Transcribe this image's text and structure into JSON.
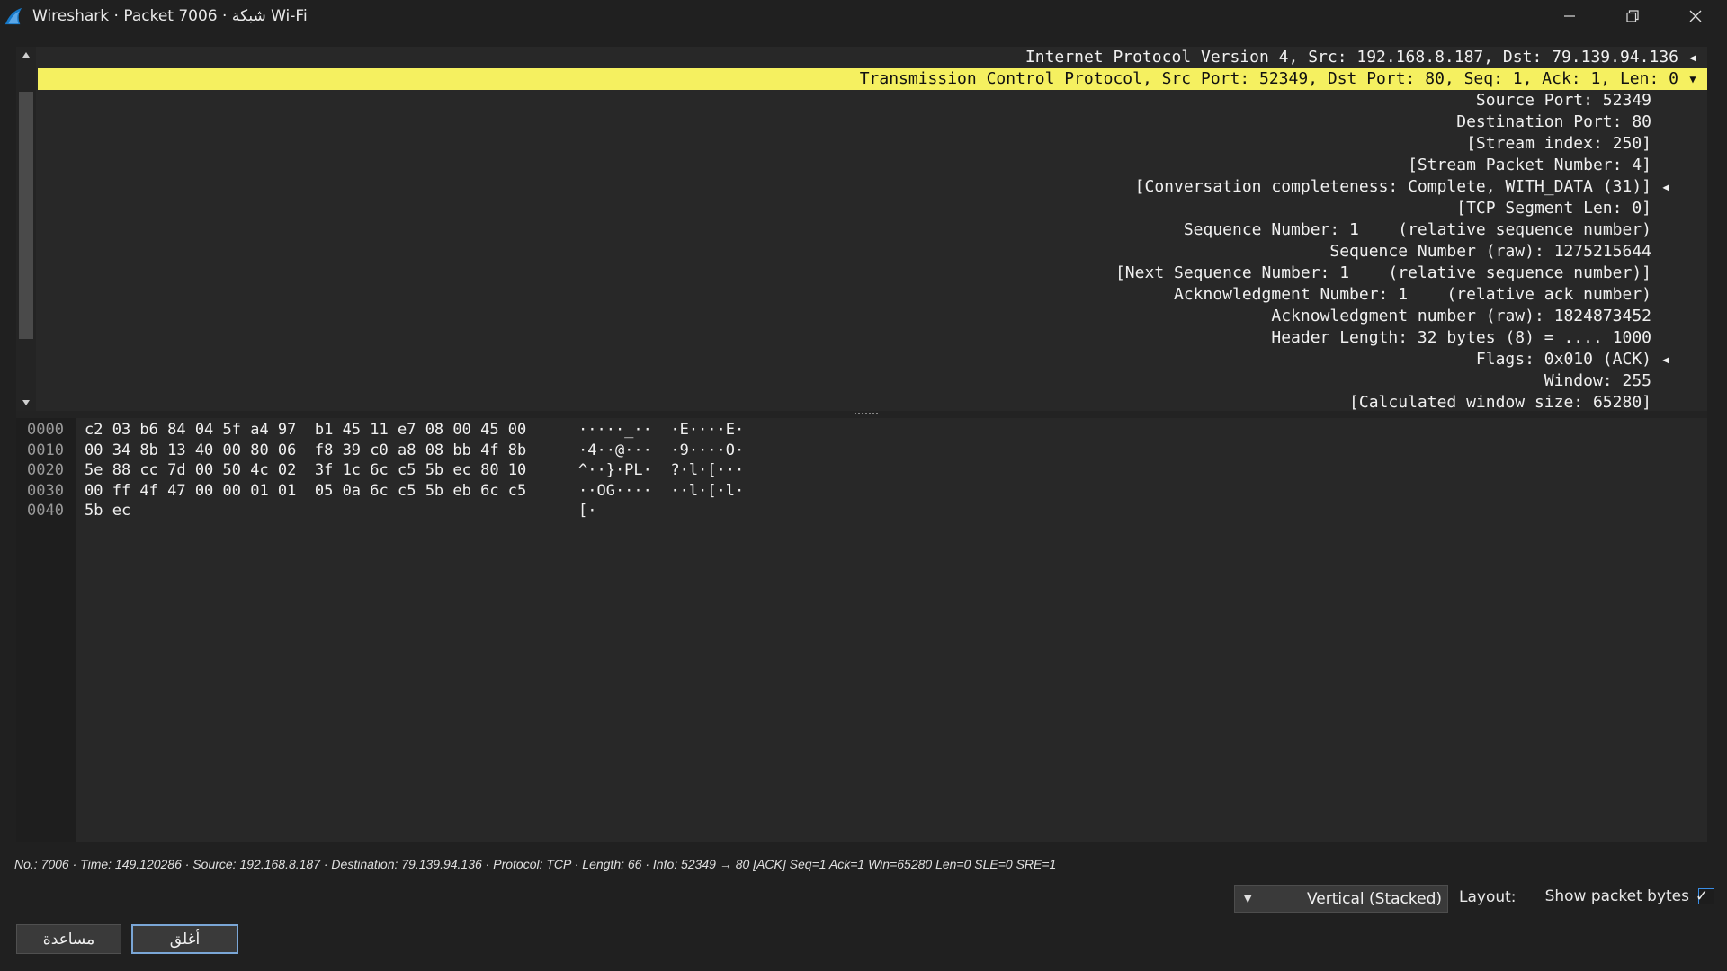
{
  "window": {
    "title": "Wireshark · Packet 7006 · شبكة Wi-Fi"
  },
  "details_tree": [
    {
      "text": "Internet Protocol Version 4, Src: 192.168.8.187, Dst: 79.139.94.136",
      "level": 0,
      "expander": "collapsed",
      "selected": false
    },
    {
      "text": "Transmission Control Protocol, Src Port: 52349, Dst Port: 80, Seq: 1, Ack: 1, Len: 0",
      "level": 0,
      "expander": "expanded",
      "selected": true
    },
    {
      "text": "Source Port: 52349",
      "level": 1
    },
    {
      "text": "Destination Port: 80",
      "level": 1
    },
    {
      "text": "[Stream index: 250]",
      "level": 1
    },
    {
      "text": "[Stream Packet Number: 4]",
      "level": 1
    },
    {
      "text": "[Conversation completeness: Complete, WITH_DATA (31)]",
      "level": 1,
      "expander": "collapsed"
    },
    {
      "text": "[TCP Segment Len: 0]",
      "level": 1
    },
    {
      "text": "Sequence Number: 1    (relative sequence number)",
      "level": 1
    },
    {
      "text": "Sequence Number (raw): 1275215644",
      "level": 1
    },
    {
      "text": "[Next Sequence Number: 1    (relative sequence number)]",
      "level": 1
    },
    {
      "text": "Acknowledgment Number: 1    (relative ack number)",
      "level": 1
    },
    {
      "text": "Acknowledgment number (raw): 1824873452",
      "level": 1
    },
    {
      "text": "Header Length: 32 bytes (8) = .... 1000",
      "level": 1
    },
    {
      "text": "Flags: 0x010 (ACK)",
      "level": 1,
      "expander": "collapsed"
    },
    {
      "text": "Window: 255",
      "level": 1
    },
    {
      "text": "[Calculated window size: 65280]",
      "level": 1
    }
  ],
  "bytes": {
    "rows": [
      {
        "offset": "0000",
        "hex": "c2 03 b6 84 04 5f a4 97  b1 45 11 e7 08 00 45 00",
        "ascii": "·····_··  ·E····E·"
      },
      {
        "offset": "0010",
        "hex": "00 34 8b 13 40 00 80 06  f8 39 c0 a8 08 bb 4f 8b",
        "ascii": "·4··@···  ·9····O·"
      },
      {
        "offset": "0020",
        "hex": "5e 88 cc 7d 00 50 4c 02  3f 1c 6c c5 5b ec 80 10",
        "ascii": "^··}·PL·  ?·l·[···"
      },
      {
        "offset": "0030",
        "hex": "00 ff 4f 47 00 00 01 01  05 0a 6c c5 5b eb 6c c5",
        "ascii": "··OG····  ··l·[·l·"
      },
      {
        "offset": "0040",
        "hex": "5b ec",
        "ascii": "[·"
      }
    ]
  },
  "status_line": "No.: 7006 · Time: 149.120286 · Source: 192.168.8.187 · Destination: 79.139.94.136 · Protocol: TCP · Length: 66 · Info: 52349 → 80 [ACK] Seq=1 Ack=1 Win=65280 Len=0 SLE=0 SRE=1",
  "controls": {
    "show_bytes_label": "Show packet bytes",
    "show_bytes_checked": true,
    "layout_label": "Layout:",
    "layout_value": "Vertical (Stacked)",
    "help_button": "مساعدة",
    "close_button": "أغلق"
  },
  "colors": {
    "background": "#202020",
    "selected_row": "#f5f060",
    "accent": "#3a8ee6"
  }
}
